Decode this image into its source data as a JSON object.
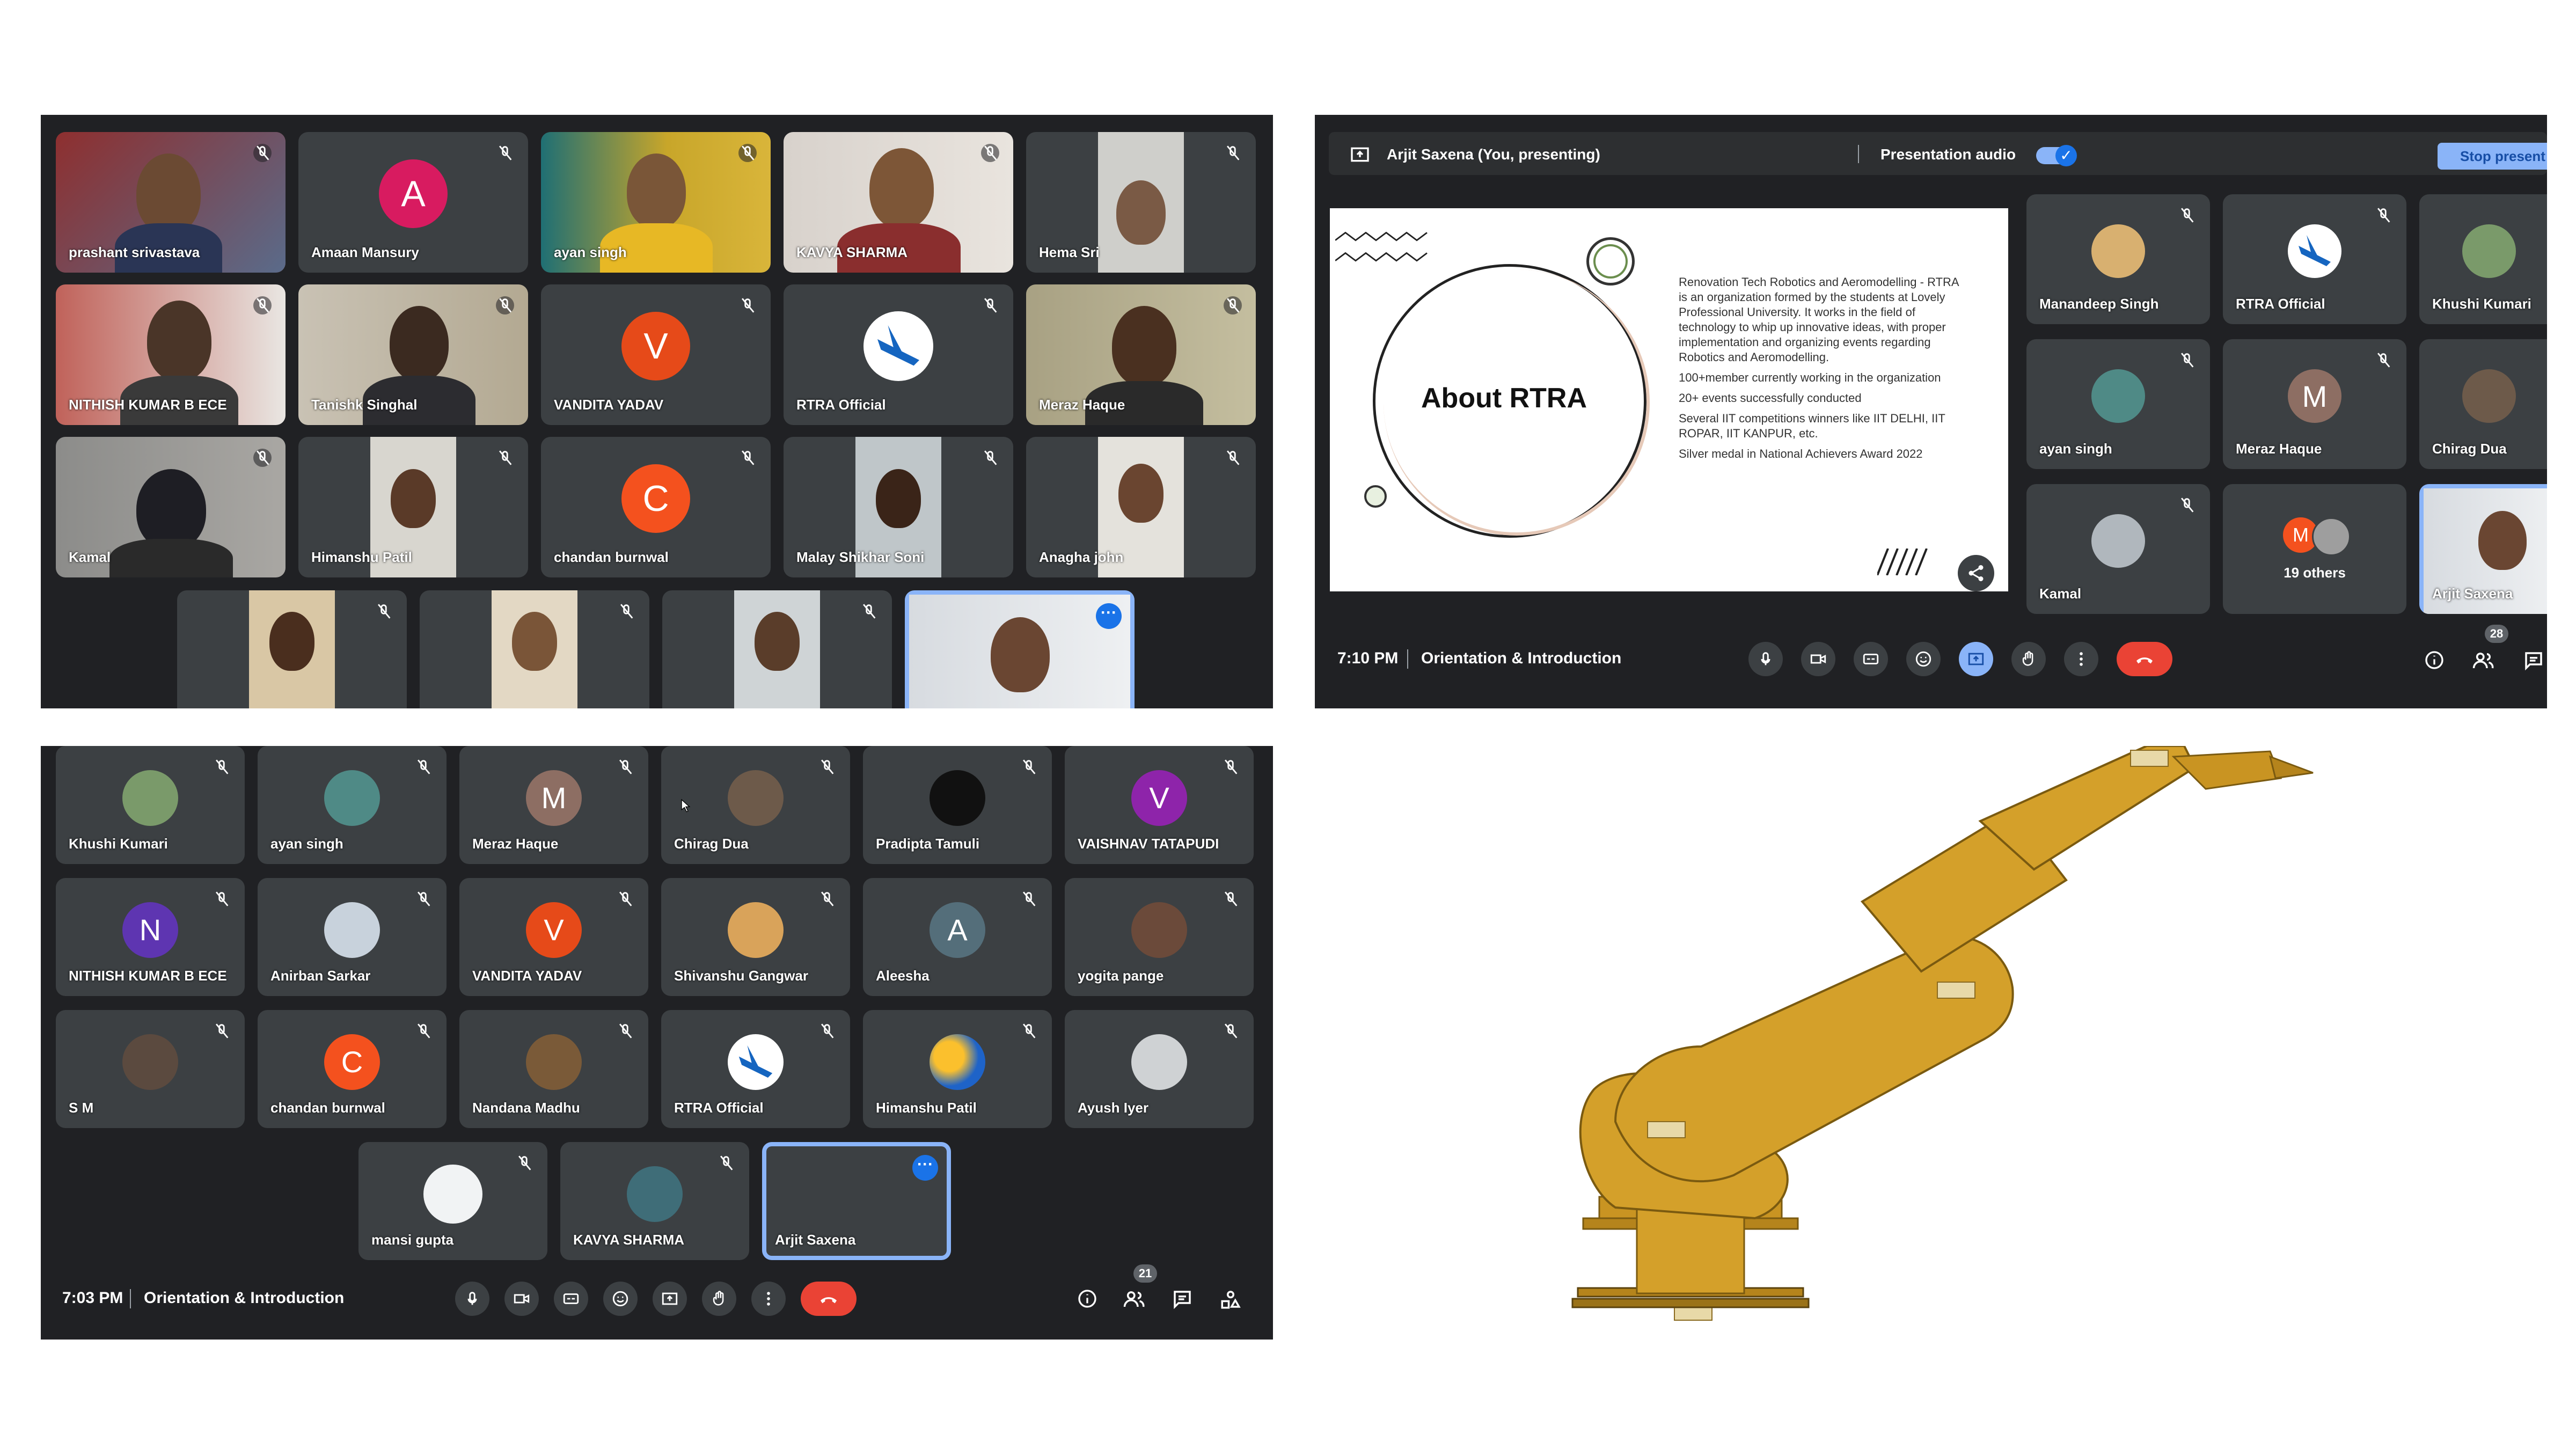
{
  "panel_a": {
    "tiles": [
      "prashant srivastava",
      "Amaan Mansury",
      "ayan singh",
      "KAVYA SHARMA",
      "Hema Sri",
      "NITHISH KUMAR B ECE",
      "Tanishk Singhal",
      "VANDITA YADAV",
      "RTRA Official",
      "Meraz Haque",
      "Kamal",
      "Himanshu Patil",
      "chandan burnwal",
      "Malay Shikhar Soni",
      "Anagha john"
    ],
    "avatar_letters": {
      "amaan": "A",
      "vandita": "V",
      "chandan": "C"
    }
  },
  "panel_b": {
    "presenting": "Arjit Saxena (You, presenting)",
    "audio_label": "Presentation audio",
    "stop_label": "Stop present",
    "slide_title": "About RTRA",
    "slide_bullets": [
      "Renovation Tech Robotics and Aeromodelling - RTRA is an organization formed by the students at Lovely Professional University. It works in the field of technology to whip up innovative ideas, with proper implementation and organizing events regarding Robotics and Aeromodelling.",
      "100+member currently working in the organization",
      "20+ events successfully conducted",
      "Several IIT competitions winners like IIT DELHI, IIT ROPAR, IIT KANPUR, etc.",
      "Silver medal in National Achievers Award 2022"
    ],
    "tiles": [
      "Manandeep Singh",
      "RTRA Official",
      "Khushi Kumari",
      "ayan singh",
      "Meraz Haque",
      "Chirag Dua",
      "Kamal",
      "19 others",
      "Arjit Saxena"
    ],
    "others_letter": "M",
    "meraz_letter": "M",
    "time": "7:10 PM",
    "meeting": "Orientation & Introduction",
    "people_count": "28"
  },
  "panel_c": {
    "tiles": [
      "Khushi Kumari",
      "ayan singh",
      "Meraz Haque",
      "Chirag Dua",
      "Pradipta Tamuli",
      "VAISHNAV TATAPUDI",
      "NITHISH KUMAR B ECE",
      "Anirban Sarkar",
      "VANDITA YADAV",
      "Shivanshu Gangwar",
      "Aleesha",
      "yogita pange",
      "S M",
      "chandan burnwal",
      "Nandana Madhu",
      "RTRA Official",
      "Himanshu Patil",
      "Ayush Iyer",
      "mansi gupta",
      "KAVYA SHARMA",
      "Arjit Saxena"
    ],
    "letters": {
      "meraz": "M",
      "vaishnav": "V",
      "nithish": "N",
      "vandita": "V",
      "aleesha": "A",
      "chandan": "C"
    },
    "time": "7:03 PM",
    "meeting": "Orientation & Introduction",
    "people_count": "21"
  },
  "colors": {
    "meet_bg": "#202124",
    "tile_bg": "#3c4043",
    "accent": "#1a73e8",
    "hangup": "#ea4335",
    "robot": "#d4a02a"
  }
}
